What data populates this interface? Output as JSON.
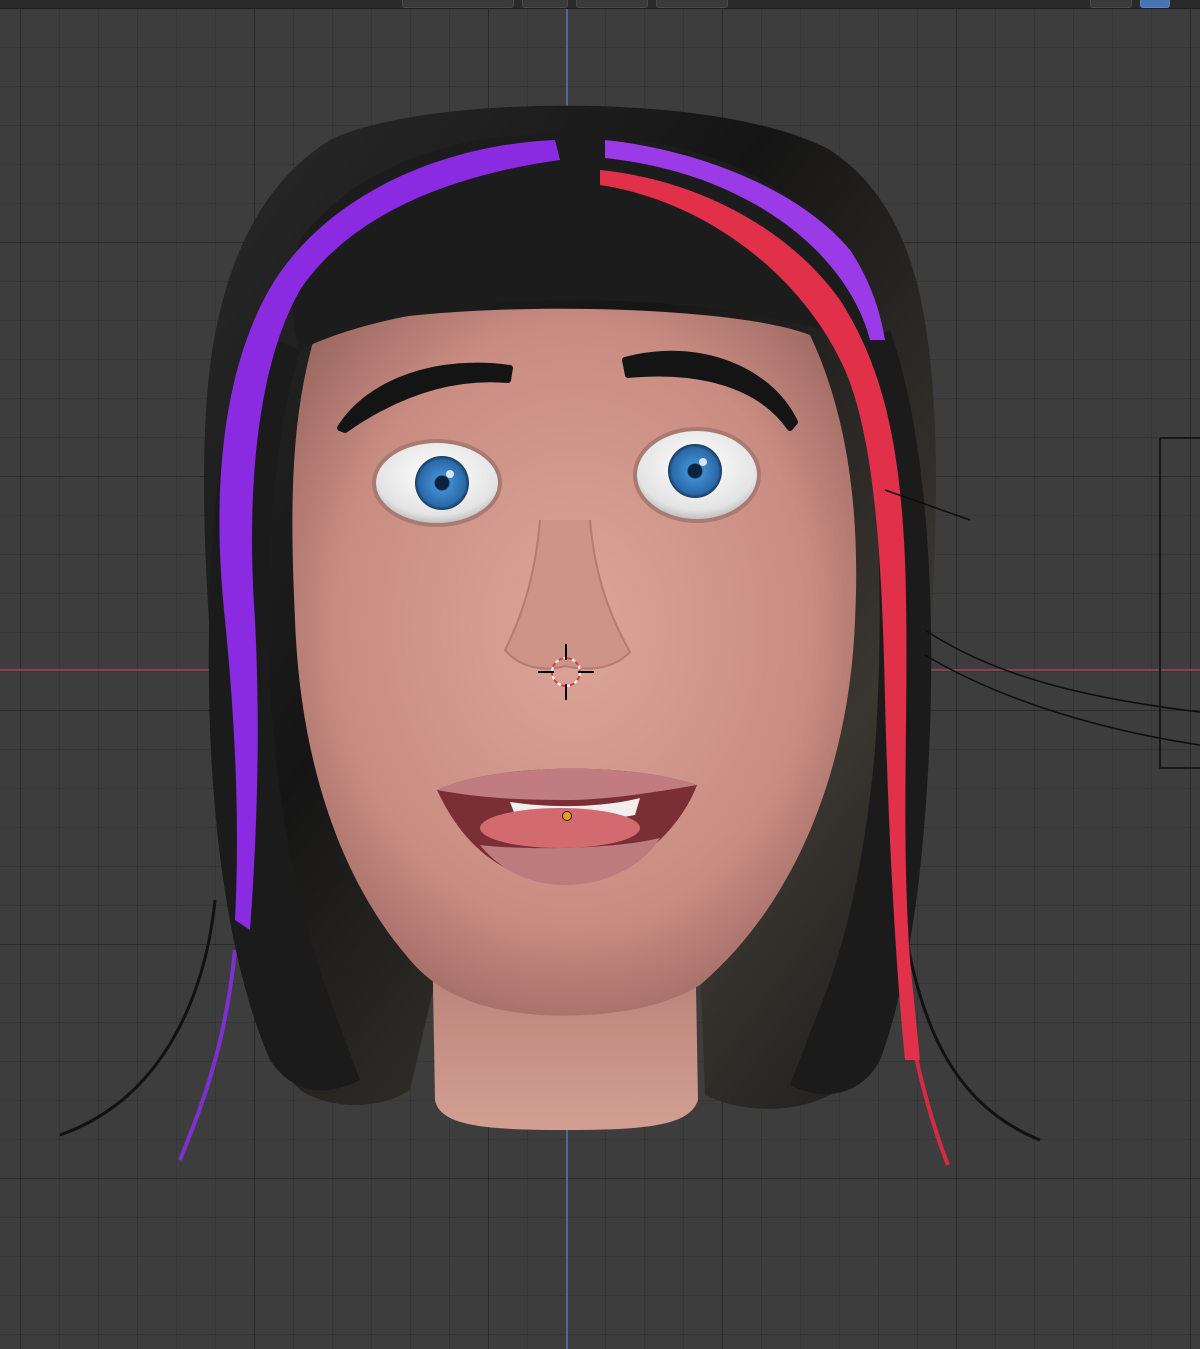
{
  "window": {
    "app": "3D viewport"
  },
  "viewport": {
    "background": "#3d3d3d",
    "grid_color": "#000000",
    "axis_x_color": "#8a4448",
    "axis_y_color": "#4b6a93"
  },
  "header": {
    "items": [
      {
        "name": "view-object-types-button",
        "icon": "object-types-icon"
      },
      {
        "name": "gizmo-toggle-button",
        "icon": "gizmo-icon"
      },
      {
        "name": "overlays-button",
        "icon": "overlays-icon"
      },
      {
        "name": "xray-toggle-button",
        "icon": "xray-icon"
      },
      {
        "name": "shading-solid-button",
        "icon": "shading-icon"
      }
    ]
  },
  "model": {
    "hair_main": "#191919",
    "hair_streak_purple": "#8a2be2",
    "hair_streak_red": "#e0304a",
    "skin": "#d49b8f",
    "iris": "#3a7fc2",
    "lips": "#b56d74"
  },
  "cursor_3d": {
    "icon": "3d-cursor-icon"
  },
  "origin": {
    "icon": "object-origin-icon",
    "color": "#f59a1e"
  }
}
